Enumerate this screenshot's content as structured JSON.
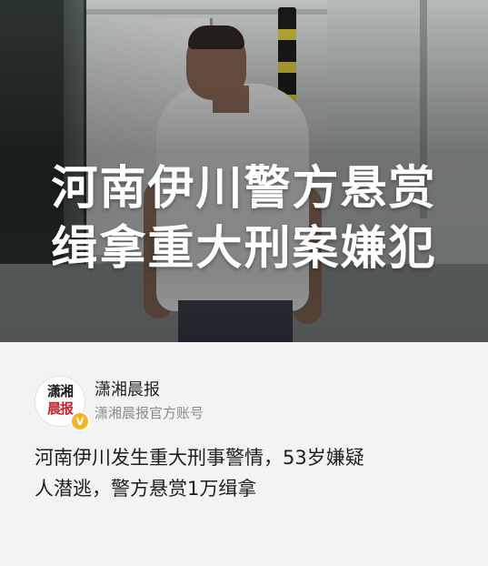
{
  "hero": {
    "headline_line1": "河南伊川警方悬赏",
    "headline_line2": "缉拿重大刑案嫌犯"
  },
  "source": {
    "logo_text_top": "潇湘",
    "logo_text_bottom": "晨报",
    "name": "潇湘晨报",
    "subtitle": "潇湘晨报官方账号",
    "verified_icon": "verified-badge-icon",
    "verified_mark": "V",
    "verified_color": "#f3b52b"
  },
  "article": {
    "summary_line1": "河南伊川发生重大刑事警情，53岁嫌疑",
    "summary_line2": "人潜逃，警方悬赏1万缉拿"
  },
  "colors": {
    "background": "#f3f3f3",
    "headline_text": "#ffffff",
    "title_text": "#1e1e1e",
    "muted_text": "#8c8c8c",
    "logo_red": "#c8232c"
  }
}
